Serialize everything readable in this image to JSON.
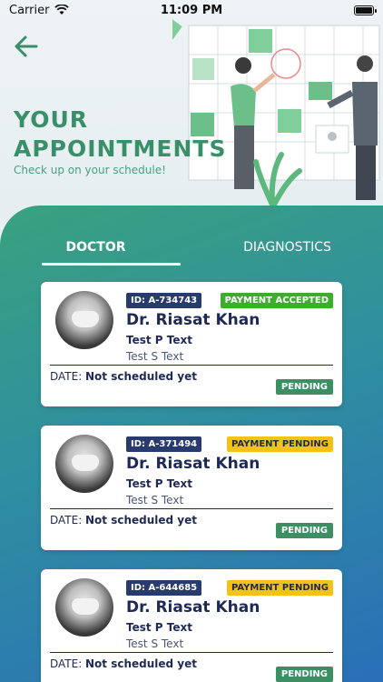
{
  "status_bar": {
    "carrier": "Carrier",
    "time": "11:09 PM"
  },
  "header": {
    "title_line1": "YOUR",
    "title_line2": "APPOINTMENTS",
    "subtitle": "Check up on your schedule!"
  },
  "tabs": [
    {
      "label": "DOCTOR",
      "active": true
    },
    {
      "label": "DIAGNOSTICS",
      "active": false
    }
  ],
  "appointments": [
    {
      "id": "ID: A-734743",
      "payment_status": "PAYMENT ACCEPTED",
      "doctor_name": "Dr. Riasat Khan",
      "p_text": "Test P Text",
      "s_text": "Test S Text",
      "date_label": "DATE:",
      "date_value": "Not scheduled yet",
      "status": "PENDING"
    },
    {
      "id": "ID: A-371494",
      "payment_status": "PAYMENT PENDING",
      "doctor_name": "Dr. Riasat Khan",
      "p_text": "Test P Text",
      "s_text": "Test S Text",
      "date_label": "DATE:",
      "date_value": "Not scheduled yet",
      "status": "PENDING"
    },
    {
      "id": "ID: A-644685",
      "payment_status": "PAYMENT PENDING",
      "doctor_name": "Dr. Riasat Khan",
      "p_text": "Test P Text",
      "s_text": "Test S Text",
      "date_label": "DATE:",
      "date_value": "Not scheduled yet",
      "status": "PENDING"
    }
  ],
  "colors": {
    "brand_green": "#3a8f6b",
    "navy": "#1e2a55",
    "payment_accepted": "#3cae2b",
    "payment_pending": "#f3c313",
    "status_pending": "#3b8f63"
  },
  "icons": {
    "back": "back-arrow-icon",
    "wifi": "wifi-icon",
    "battery": "battery-icon"
  }
}
